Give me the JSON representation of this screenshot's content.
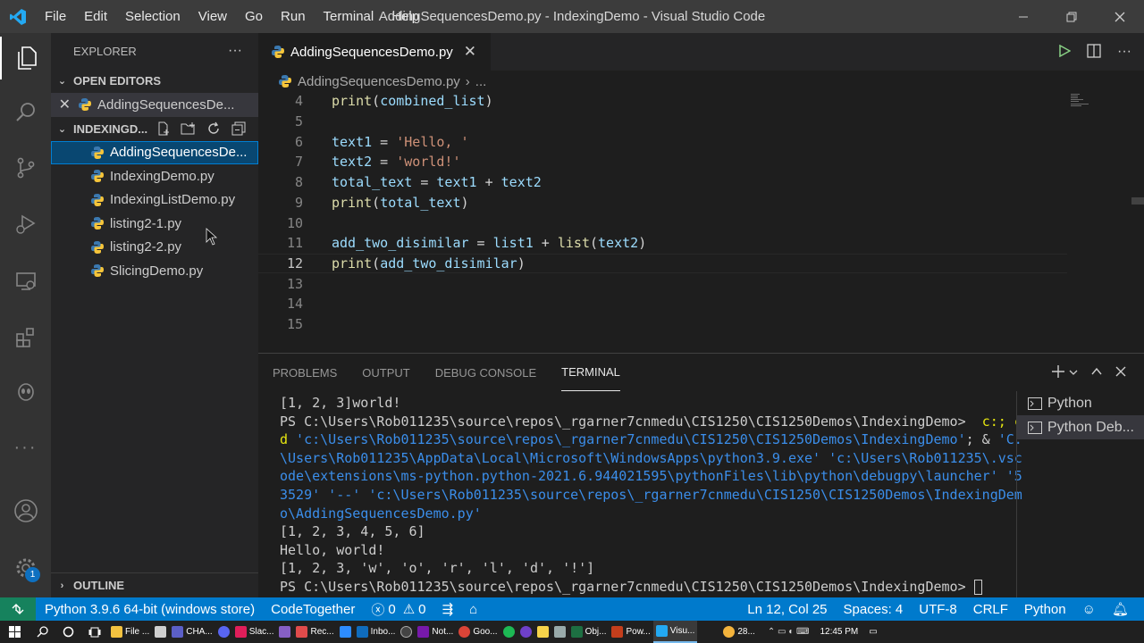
{
  "titlebar": {
    "menu": [
      "File",
      "Edit",
      "Selection",
      "View",
      "Go",
      "Run",
      "Terminal",
      "Help"
    ],
    "window_title": "AddingSequencesDemo.py - IndexingDemo - Visual Studio Code"
  },
  "activity_bar": {
    "items": [
      "explorer-icon",
      "search-icon",
      "source-control-icon",
      "run-debug-icon",
      "remote-explorer-icon",
      "extensions-icon",
      "alien-extension-icon",
      "more-icon"
    ],
    "bottom": [
      "account-icon",
      "settings-gear-icon"
    ],
    "settings_badge": "1"
  },
  "sidebar": {
    "header": "EXPLORER",
    "open_editors_label": "OPEN EDITORS",
    "open_editors": [
      {
        "name": "AddingSequencesDe..."
      }
    ],
    "folder_label": "INDEXINGD...",
    "files": [
      {
        "name": "AddingSequencesDe...",
        "selected": true
      },
      {
        "name": "IndexingDemo.py"
      },
      {
        "name": "IndexingListDemo.py"
      },
      {
        "name": "listing2-1.py"
      },
      {
        "name": "listing2-2.py"
      },
      {
        "name": "SlicingDemo.py"
      }
    ],
    "outline_label": "OUTLINE"
  },
  "editor": {
    "tab_label": "AddingSequencesDemo.py",
    "breadcrumb_file": "AddingSequencesDemo.py",
    "breadcrumb_more": "...",
    "lines": [
      {
        "n": "4",
        "text": "print(combined_list)"
      },
      {
        "n": "5",
        "text": ""
      },
      {
        "n": "6",
        "text": "text1 = 'Hello, '"
      },
      {
        "n": "7",
        "text": "text2 = 'world!'"
      },
      {
        "n": "8",
        "text": "total_text = text1 + text2"
      },
      {
        "n": "9",
        "text": "print(total_text)"
      },
      {
        "n": "10",
        "text": ""
      },
      {
        "n": "11",
        "text": "add_two_disimilar = list1 + list(text2)"
      },
      {
        "n": "12",
        "text": "print(add_two_disimilar)"
      },
      {
        "n": "13",
        "text": ""
      },
      {
        "n": "14",
        "text": ""
      },
      {
        "n": "15",
        "text": ""
      }
    ],
    "current_line": "12"
  },
  "panel": {
    "tabs": [
      "PROBLEMS",
      "OUTPUT",
      "DEBUG CONSOLE",
      "TERMINAL"
    ],
    "active_tab": "TERMINAL",
    "terminal_lines": [
      {
        "text": "[1, 2, 3]world!",
        "style": "plain"
      },
      {
        "prefix": "PS C:\\Users\\Rob011235\\source\\repos\\_rgarner7cnmedu\\CIS1250\\CIS1250Demos\\IndexingDemo>  ",
        "yellow": "c:; c",
        "style": "prompt"
      },
      {
        "prefix": "",
        "yellow": "d",
        "blue": " 'c:\\Users\\Rob011235\\source\\repos\\_rgarner7cnmedu\\CIS1250\\CIS1250Demos\\IndexingDemo'",
        "tail": "; & ",
        "blue2": "'C:",
        "style": "mixed"
      },
      {
        "text": "\\Users\\Rob011235\\AppData\\Local\\Microsoft\\WindowsApps\\python3.9.exe' 'c:\\Users\\Rob011235\\.vsc",
        "style": "blue"
      },
      {
        "text": "ode\\extensions\\ms-python.python-2021.6.944021595\\pythonFiles\\lib\\python\\debugpy\\launcher' '5",
        "style": "blue"
      },
      {
        "text": "3529' '--' 'c:\\Users\\Rob011235\\source\\repos\\_rgarner7cnmedu\\CIS1250\\CIS1250Demos\\IndexingDem",
        "style": "blue"
      },
      {
        "text": "o\\AddingSequencesDemo.py'",
        "style": "blue"
      },
      {
        "text": "[1, 2, 3, 4, 5, 6]",
        "style": "plain"
      },
      {
        "text": "Hello, world!",
        "style": "plain"
      },
      {
        "text": "[1, 2, 3, 'w', 'o', 'r', 'l', 'd', '!']",
        "style": "plain"
      },
      {
        "text": "PS C:\\Users\\Rob011235\\source\\repos\\_rgarner7cnmedu\\CIS1250\\CIS1250Demos\\IndexingDemo> ",
        "style": "final"
      }
    ],
    "terminal_instances": [
      "Python",
      "Python Deb..."
    ]
  },
  "statusbar": {
    "interpreter": "Python 3.9.6 64-bit (windows store)",
    "codetogether": "CodeTogether",
    "errors": "0",
    "warnings": "0",
    "position": "Ln 12, Col 25",
    "spaces": "Spaces: 4",
    "encoding": "UTF-8",
    "eol": "CRLF",
    "language": "Python"
  },
  "taskbar": {
    "items": [
      "File ...",
      "CHA...",
      "Slac...",
      "Rec...",
      "Inbo...",
      "Not...",
      "Goo...",
      "Obj...",
      "Pow...",
      "Visu..."
    ],
    "weather": "28...",
    "clock": "12:45 PM"
  },
  "colors": {
    "accent": "#007acc",
    "selection": "#094771",
    "remote": "#16825d"
  }
}
